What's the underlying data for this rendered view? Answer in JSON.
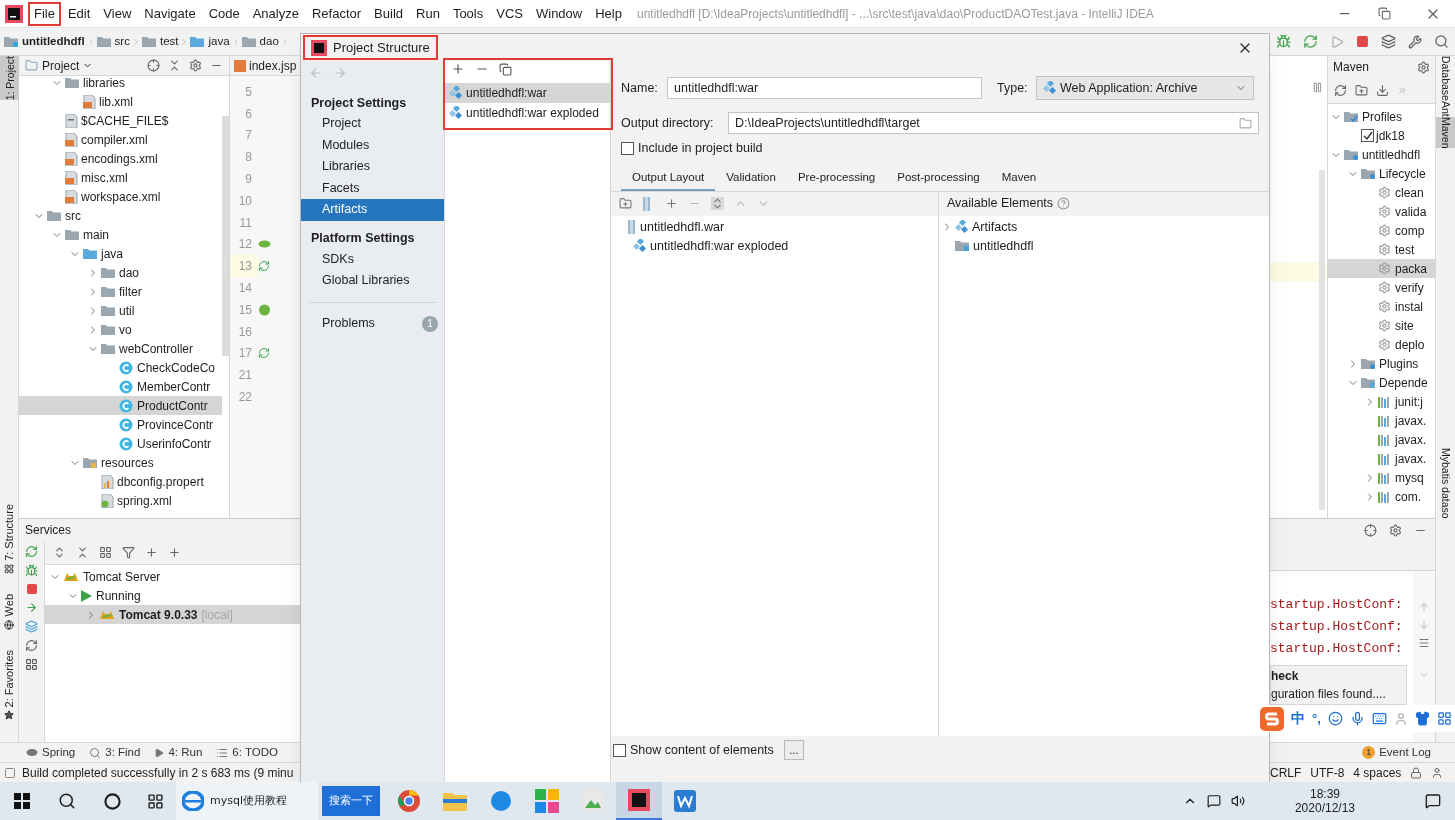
{
  "menu_bar": {
    "items": [
      {
        "label": "File",
        "highlighted": true
      },
      {
        "label": "Edit",
        "highlighted": false
      },
      {
        "label": "View",
        "highlighted": false
      },
      {
        "label": "Navigate",
        "highlighted": false
      },
      {
        "label": "Code",
        "highlighted": false
      },
      {
        "label": "Analyze",
        "highlighted": false
      },
      {
        "label": "Refactor",
        "highlighted": false
      },
      {
        "label": "Build",
        "highlighted": false
      },
      {
        "label": "Run",
        "highlighted": false
      },
      {
        "label": "Tools",
        "highlighted": false
      },
      {
        "label": "VCS",
        "highlighted": false
      },
      {
        "label": "Window",
        "highlighted": false
      },
      {
        "label": "Help",
        "highlighted": false
      }
    ],
    "title": "untitledhdfl [D:\\IdeaProjects\\untitledhdfl] - ...\\src\\test\\java\\dao\\ProductDAOTest.java - IntelliJ IDEA"
  },
  "breadcrumbs": [
    {
      "label": "untitledhdfl",
      "kind": "module"
    },
    {
      "label": "src",
      "kind": "folder"
    },
    {
      "label": "test",
      "kind": "folder"
    },
    {
      "label": "java",
      "kind": "source"
    },
    {
      "label": "dao",
      "kind": "package"
    }
  ],
  "left_strip": {
    "top": [
      {
        "label": "1: Project",
        "selected": true
      }
    ],
    "bottom": [
      {
        "label": "7: Structure",
        "kind": "structure"
      },
      {
        "label": "Web",
        "kind": "web"
      },
      {
        "label": "2: Favorites",
        "kind": "favorites"
      }
    ]
  },
  "project_panel": {
    "title": "Project",
    "tree": [
      {
        "children": [
          {
            "label": "libraries",
            "kind": "folder",
            "expanded": true,
            "selected": false,
            "children": [
              {
                "label": "lib.xml",
                "kind": "xml",
                "selected": false
              }
            ]
          },
          {
            "label": "$CACHE_FILE$",
            "kind": "file",
            "selected": false
          },
          {
            "label": "compiler.xml",
            "kind": "xml",
            "selected": false
          },
          {
            "label": "encodings.xml",
            "kind": "xml",
            "selected": false
          },
          {
            "label": "misc.xml",
            "kind": "xml",
            "selected": false
          },
          {
            "label": "workspace.xml",
            "kind": "xml",
            "selected": false
          }
        ]
      },
      {
        "label": "src",
        "kind": "folder",
        "expanded": true,
        "selected": false,
        "children": [
          {
            "label": "main",
            "kind": "folder",
            "expanded": true,
            "selected": false,
            "children": [
              {
                "label": "java",
                "kind": "source",
                "expanded": true,
                "selected": false,
                "children": [
                  {
                    "label": "dao",
                    "kind": "package",
                    "expanded": false,
                    "selected": false
                  },
                  {
                    "label": "filter",
                    "kind": "package",
                    "expanded": false,
                    "selected": false
                  },
                  {
                    "label": "util",
                    "kind": "package",
                    "expanded": false,
                    "selected": false
                  },
                  {
                    "label": "vo",
                    "kind": "package",
                    "expanded": false,
                    "selected": false
                  },
                  {
                    "label": "webController",
                    "kind": "package",
                    "expanded": true,
                    "selected": false,
                    "children": [
                      {
                        "label": "CheckCodeCo",
                        "kind": "class",
                        "selected": false
                      },
                      {
                        "label": "MemberContr",
                        "kind": "class",
                        "selected": false
                      },
                      {
                        "label": "ProductContr",
                        "kind": "class",
                        "selected": true
                      },
                      {
                        "label": "ProvinceContr",
                        "kind": "class",
                        "selected": false
                      },
                      {
                        "label": "UserinfoContr",
                        "kind": "class",
                        "selected": false
                      }
                    ]
                  }
                ]
              },
              {
                "label": "resources",
                "kind": "resources",
                "expanded": true,
                "selected": false,
                "children": [
                  {
                    "label": "dbconfig.propert",
                    "kind": "properties",
                    "selected": false
                  },
                  {
                    "label": "spring.xml",
                    "kind": "spring",
                    "selected": false
                  }
                ]
              }
            ]
          }
        ]
      }
    ]
  },
  "editor": {
    "tab": "index.jsp",
    "lines": [
      {
        "number": "5",
        "kind": "plain",
        "current": false
      },
      {
        "number": "6",
        "kind": "plain",
        "current": false
      },
      {
        "number": "7",
        "kind": "plain",
        "current": false
      },
      {
        "number": "8",
        "kind": "plain",
        "current": false
      },
      {
        "number": "9",
        "kind": "plain",
        "current": false
      },
      {
        "number": "10",
        "kind": "plain",
        "current": false
      },
      {
        "number": "11",
        "kind": "plain",
        "current": false
      },
      {
        "number": "12",
        "kind": "leaf",
        "current": false
      },
      {
        "number": "13",
        "kind": "run",
        "current": true
      },
      {
        "number": "14",
        "kind": "plain",
        "current": false
      },
      {
        "number": "15",
        "kind": "bean",
        "current": false
      },
      {
        "number": "16",
        "kind": "plain",
        "current": false
      },
      {
        "number": "17",
        "kind": "run",
        "current": false
      },
      {
        "number": "21",
        "kind": "plain",
        "current": false
      },
      {
        "number": "22",
        "kind": "plain",
        "current": false
      }
    ]
  },
  "services": {
    "title": "Services",
    "tree": [
      {
        "label": "Tomcat Server",
        "kind": "tomcat",
        "expanded": true,
        "selected": false,
        "active": false,
        "children": [
          {
            "label": "Running",
            "kind": "run",
            "expanded": true,
            "selected": false,
            "active": false,
            "children": [
              {
                "label": "Tomcat 9.0.33",
                "note": "[local]",
                "kind": "tomcat",
                "expanded": false,
                "selected": true,
                "active": true
              }
            ]
          }
        ]
      }
    ],
    "log_lines": [
      "startup.HostConf:",
      "startup.HostConf:",
      "startup.HostConf:"
    ],
    "notification": {
      "title": "heck",
      "text": "guration files found...."
    }
  },
  "maven": {
    "title": "Maven",
    "tree": [
      {
        "label": "Profiles",
        "kind": "profiles",
        "expanded": true,
        "selected": false,
        "children": [
          {
            "label": "jdk18",
            "kind": "checkbox",
            "checked": true,
            "selected": false
          }
        ]
      },
      {
        "label": "untitledhdfl",
        "kind": "maven-module",
        "expanded": true,
        "selected": false,
        "children": [
          {
            "label": "Lifecycle",
            "kind": "lifecycle",
            "expanded": true,
            "selected": false,
            "children": [
              {
                "label": "clean",
                "kind": "gear",
                "selected": false
              },
              {
                "label": "valida",
                "kind": "gear",
                "selected": false
              },
              {
                "label": "comp",
                "kind": "gear",
                "selected": false
              },
              {
                "label": "test",
                "kind": "gear",
                "selected": false
              },
              {
                "label": "packa",
                "kind": "gear",
                "selected": true
              },
              {
                "label": "verify",
                "kind": "gear",
                "selected": false
              },
              {
                "label": "instal",
                "kind": "gear",
                "selected": false
              },
              {
                "label": "site",
                "kind": "gear",
                "selected": false
              },
              {
                "label": "deplo",
                "kind": "gear",
                "selected": false
              }
            ]
          },
          {
            "label": "Plugins",
            "kind": "lifecycle",
            "expanded": false,
            "selected": false
          },
          {
            "label": "Depende",
            "kind": "deps",
            "expanded": true,
            "selected": false,
            "children": [
              {
                "label": "junit:j",
                "kind": "library",
                "expanded": false,
                "selected": false
              },
              {
                "label": "javax.",
                "kind": "library",
                "selected": false
              },
              {
                "label": "javax.",
                "kind": "library",
                "selected": false
              },
              {
                "label": "javax.",
                "kind": "library",
                "selected": false
              },
              {
                "label": "mysq",
                "kind": "library",
                "expanded": false,
                "selected": false
              },
              {
                "label": "com.",
                "kind": "library",
                "expanded": false,
                "selected": false
              }
            ]
          }
        ]
      }
    ]
  },
  "right_strip": [
    {
      "label": "Database",
      "selected": false
    },
    {
      "label": "Ant",
      "selected": false
    },
    {
      "label": "Maven",
      "selected": true
    },
    {
      "label": "Mybatis dataso",
      "selected": false
    }
  ],
  "dialog": {
    "title": "Project Structure",
    "title_highlighted": true,
    "sections": [
      {
        "header": "Project Settings",
        "items": [
          {
            "label": "Project",
            "selected": false
          },
          {
            "label": "Modules",
            "selected": false
          },
          {
            "label": "Libraries",
            "selected": false
          },
          {
            "label": "Facets",
            "selected": false
          },
          {
            "label": "Artifacts",
            "selected": true
          }
        ]
      },
      {
        "header": "Platform Settings",
        "items": [
          {
            "label": "SDKs",
            "selected": false
          },
          {
            "label": "Global Libraries",
            "selected": false
          }
        ]
      }
    ],
    "problems": {
      "label": "Problems",
      "count": "1"
    },
    "artifacts": {
      "highlighted": true,
      "items": [
        {
          "label": "untitledhdfl:war",
          "selected": true
        },
        {
          "label": "untitledhdfl:war exploded",
          "selected": false
        }
      ]
    },
    "name_label": "Name:",
    "name_value": "untitledhdfl:war",
    "type_label": "Type:",
    "type_value": "Web Application: Archive",
    "output_label": "Output directory:",
    "output_value": "D:\\IdeaProjects\\untitledhdfl\\target",
    "include_build": {
      "label": "Include in project build",
      "checked": false
    },
    "tabs": [
      {
        "label": "Output Layout",
        "selected": true
      },
      {
        "label": "Validation",
        "selected": false
      },
      {
        "label": "Pre-processing",
        "selected": false
      },
      {
        "label": "Post-processing",
        "selected": false
      },
      {
        "label": "Maven",
        "selected": false
      }
    ],
    "layout_tree": [
      {
        "label": "untitledhdfl.war",
        "kind": "archive",
        "selected": false,
        "children": [
          {
            "label": "untitledhdfl:war exploded",
            "kind": "artifact",
            "selected": false
          }
        ]
      }
    ],
    "available": {
      "title": "Available Elements",
      "tree": [
        {
          "label": "Artifacts",
          "kind": "artifact",
          "expanded": false,
          "selected": false
        },
        {
          "label": "untitledhdfl",
          "kind": "module",
          "selected": false
        }
      ]
    },
    "show_content": {
      "label": "Show content of elements",
      "checked": false
    },
    "more_button": "..."
  },
  "bottom_tabs": [
    {
      "label": "Spring",
      "kind": "spring"
    },
    {
      "label": "3: Find",
      "kind": "find"
    },
    {
      "label": "4: Run",
      "kind": "run"
    },
    {
      "label": "6: TODO",
      "kind": "todo"
    }
  ],
  "event_log": {
    "label": "Event Log",
    "count": "1"
  },
  "status_bar": {
    "message": "Build completed successfully in 2 s 683 ms (9 minu",
    "items": [
      "CRLF",
      "UTF-8",
      "4 spaces"
    ]
  },
  "ime_bar": {
    "mode": "中",
    "punct": "°,"
  },
  "taskbar": {
    "browser_tab": "mysql使用教程",
    "search_button": "搜索一下",
    "time": "18:39",
    "date": "2020/12/13"
  }
}
